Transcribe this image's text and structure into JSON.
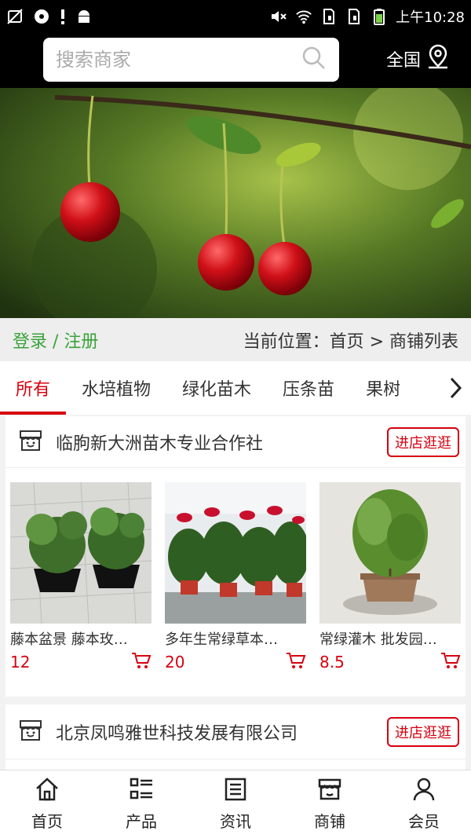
{
  "status_bar": {
    "time": "上午10:28",
    "left_icons": [
      "no-image-icon",
      "record-icon",
      "alert-icon",
      "android-icon"
    ],
    "right_icons": [
      "mute-icon",
      "wifi-icon",
      "sim1-icon",
      "sim2-icon",
      "battery-icon"
    ]
  },
  "header": {
    "search_placeholder": "搜索商家",
    "region_label": "全国"
  },
  "crumb": {
    "login_register": "登录 / 注册",
    "location": "当前位置：首页 > 商铺列表"
  },
  "tabs": [
    {
      "label": "所有",
      "active": true
    },
    {
      "label": "水培植物"
    },
    {
      "label": "绿化苗木"
    },
    {
      "label": "压条苗"
    },
    {
      "label": "果树"
    }
  ],
  "shops": [
    {
      "name": "临朐新大洲苗木专业合作社",
      "visit_label": "进店逛逛",
      "products": [
        {
          "name": "藤本盆景 藤本玫…",
          "price": "12"
        },
        {
          "name": "多年生常绿草本…",
          "price": "20"
        },
        {
          "name": "常绿灌木 批发园…",
          "price": "8.5"
        }
      ]
    },
    {
      "name": "北京凤鸣雅世科技发展有限公司",
      "visit_label": "进店逛逛"
    }
  ],
  "bottom_nav": [
    {
      "label": "首页",
      "icon": "home-icon"
    },
    {
      "label": "产品",
      "icon": "list-icon"
    },
    {
      "label": "资讯",
      "icon": "news-icon"
    },
    {
      "label": "商铺",
      "icon": "shop-icon"
    },
    {
      "label": "会员",
      "icon": "user-icon"
    }
  ],
  "colors": {
    "accent": "#d7000f",
    "login": "#3aa33a"
  }
}
